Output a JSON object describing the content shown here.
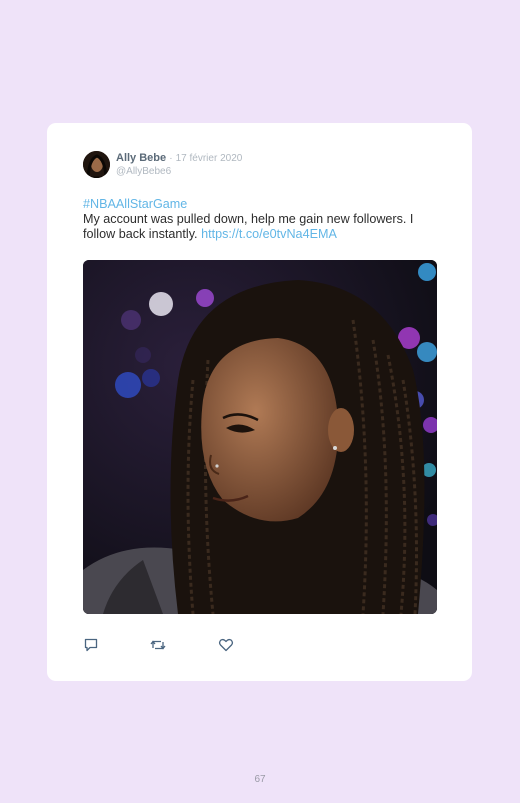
{
  "tweet": {
    "author_name": "Ally Bebe",
    "separator": "·",
    "date": "17 février 2020",
    "handle": "@AllyBebe6",
    "hashtag": "#NBAAllStarGame",
    "text": "My account was pulled down, help me gain new followers. I follow back instantly.",
    "link": "https://t.co/e0tvNa4EMA",
    "actions": [
      "reply-icon",
      "retweet-icon",
      "like-icon"
    ]
  },
  "page": {
    "number": "67"
  },
  "colors": {
    "background": "#efe3f9",
    "card": "#ffffff",
    "link": "#62b6e6",
    "name": "#5b6a78"
  }
}
